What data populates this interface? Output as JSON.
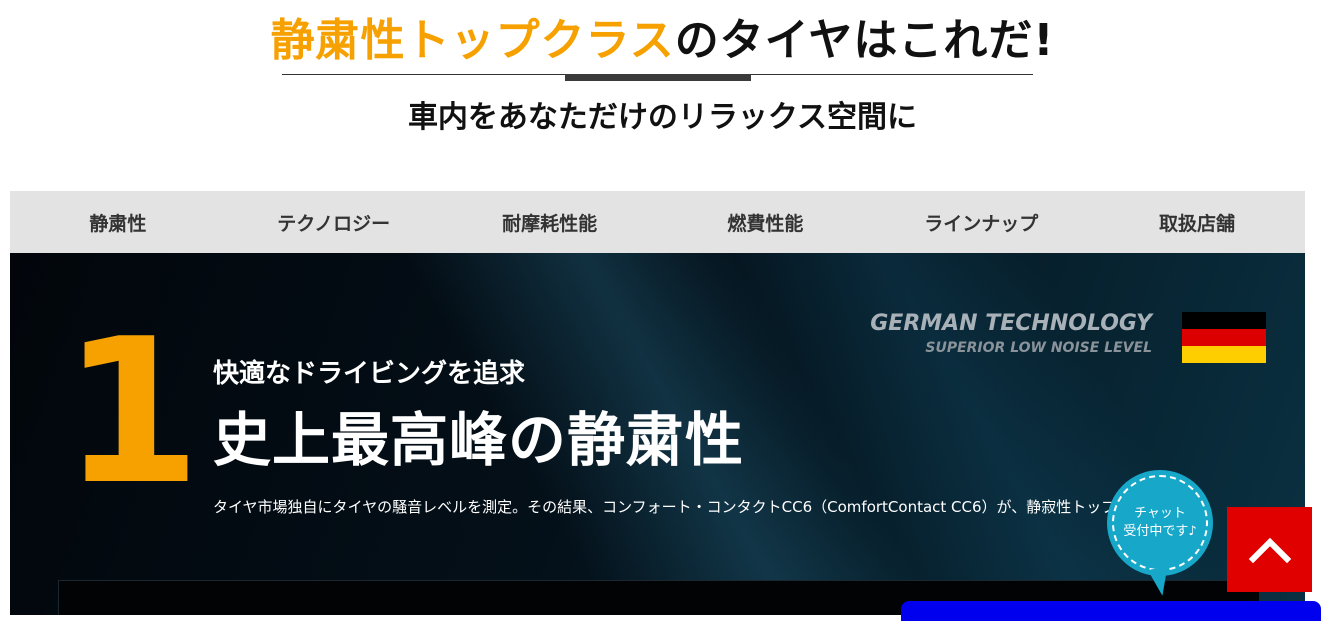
{
  "header": {
    "headline_accent": "静粛性トップクラス",
    "headline_rest": "のタイヤはこれだ!",
    "subheadline": "車内をあなただけのリラックス空間に"
  },
  "tabs": [
    {
      "label": "静粛性"
    },
    {
      "label": "テクノロジー"
    },
    {
      "label": "耐摩耗性能"
    },
    {
      "label": "燃費性能"
    },
    {
      "label": "ラインナップ"
    },
    {
      "label": "取扱店舗"
    }
  ],
  "hero": {
    "number": "1",
    "kicker": "快適なドライビングを追求",
    "title": "史上最高峰の静粛性",
    "body": "タイヤ市場独自にタイヤの騒音レベルを測定。その結果、コンフォート・コンタクトCC6（ComfortContact CC6）が、静寂性トップにラン",
    "badge_title": "GERMAN TECHNOLOGY",
    "badge_subtitle": "SUPERIOR LOW NOISE LEVEL",
    "flag_colors": [
      "#000000",
      "#dd0000",
      "#ffce00"
    ]
  },
  "chat": {
    "line1": "チャット",
    "line2": "受付中です♪"
  },
  "colors": {
    "accent": "#f6a100",
    "chat": "#17a7c9",
    "scroll_top": "#e00000"
  }
}
